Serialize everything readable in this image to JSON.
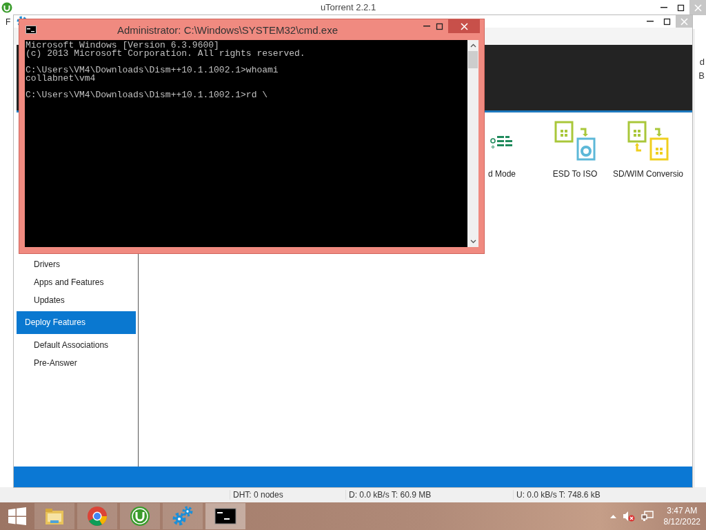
{
  "utorrent": {
    "title": "uTorrent 2.2.1",
    "menu": [
      "F"
    ],
    "column_fragments": [
      "d",
      "B"
    ],
    "status_bar": [
      "DHT: 0 nodes",
      "D: 0.0 kB/s T: 60.9 MB",
      "U: 0.0 kB/s T: 748.6 kB"
    ]
  },
  "dism": {
    "sidebar": [
      {
        "label": "Drivers",
        "kind": "item"
      },
      {
        "label": "Apps and Features",
        "kind": "item"
      },
      {
        "label": "Updates",
        "kind": "item"
      },
      {
        "label": "Deploy Features",
        "kind": "group"
      },
      {
        "label": "Default Associations",
        "kind": "item"
      },
      {
        "label": "Pre-Answer",
        "kind": "item"
      }
    ],
    "tools": [
      {
        "label": "d Mode",
        "kind": "list"
      },
      {
        "label": "ESD To ISO",
        "kind": "esd-iso"
      },
      {
        "label": "SD/WIM Conversio",
        "kind": "wim-convert"
      }
    ]
  },
  "cmd": {
    "title": "Administrator: C:\\Windows\\SYSTEM32\\cmd.exe",
    "blocks": [
      [
        "Microsoft Windows [Version 6.3.9600]",
        "(c) 2013 Microsoft Corporation. All rights reserved."
      ],
      [
        "C:\\Users\\VM4\\Downloads\\Dism++10.1.1002.1>whoami",
        "collabnet\\vm4"
      ],
      [
        "C:\\Users\\VM4\\Downloads\\Dism++10.1.1002.1>rd \\"
      ]
    ]
  },
  "taskbar": {
    "apps": [
      {
        "kind": "explorer",
        "selected": false
      },
      {
        "kind": "chrome",
        "selected": false
      },
      {
        "kind": "utorrent",
        "selected": false
      },
      {
        "kind": "gears",
        "selected": false
      },
      {
        "kind": "console",
        "selected": true
      }
    ],
    "clock": {
      "time": "3:47 AM",
      "date": "8/12/2022"
    }
  }
}
